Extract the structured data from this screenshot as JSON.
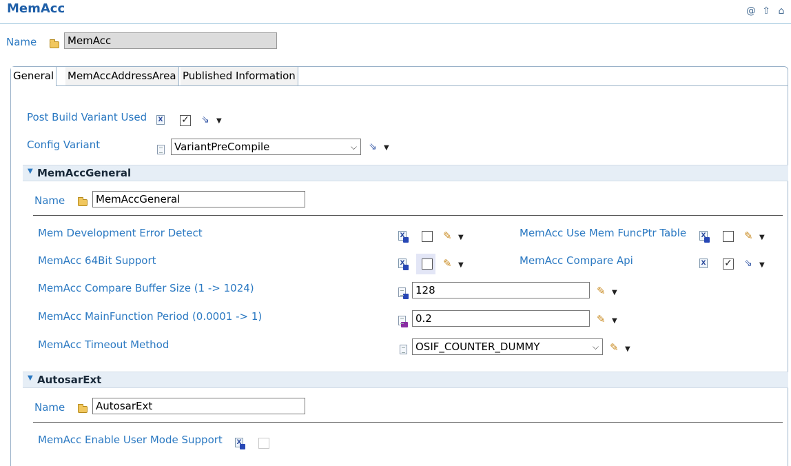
{
  "header": {
    "title": "MemAcc",
    "icons": [
      "at-icon",
      "up-arrow-icon",
      "home-icon"
    ]
  },
  "top_name": {
    "label": "Name",
    "value": "MemAcc"
  },
  "tabs": [
    {
      "label": "General",
      "active": true
    },
    {
      "label": "MemAccAddressArea",
      "active": false
    },
    {
      "label": "Published Information",
      "active": false
    }
  ],
  "general": {
    "post_build_variant_used": {
      "label": "Post Build Variant Used",
      "checked": true
    },
    "config_variant": {
      "label": "Config Variant",
      "value": "VariantPreCompile"
    }
  },
  "mem_acc_general": {
    "title": "MemAccGeneral",
    "name": {
      "label": "Name",
      "value": "MemAccGeneral"
    },
    "dev_error_detect": {
      "label": "Mem Development Error Detect",
      "checked": false
    },
    "support_64bit": {
      "label": "MemAcc 64Bit Support",
      "checked": false
    },
    "use_funcptr_table": {
      "label": "MemAcc Use Mem FuncPtr Table",
      "checked": false
    },
    "compare_api": {
      "label": "MemAcc Compare Api",
      "checked": true
    },
    "compare_buffer_size": {
      "label": "MemAcc Compare Buffer Size (1 -> 1024)",
      "value": "128"
    },
    "main_function_period": {
      "label": "MemAcc MainFunction Period (0.0001 -> 1)",
      "value": "0.2"
    },
    "timeout_method": {
      "label": "MemAcc Timeout Method",
      "value": "OSIF_COUNTER_DUMMY"
    }
  },
  "autosar_ext": {
    "title": "AutosarExt",
    "name": {
      "label": "Name",
      "value": "AutosarExt"
    },
    "enable_user_mode_support": {
      "label": "MemAcc Enable User Mode Support",
      "checked": false
    }
  },
  "colors": {
    "label_blue": "#2b79c2",
    "title_blue": "#1f5fa8",
    "section_bg": "#e6eef6"
  }
}
